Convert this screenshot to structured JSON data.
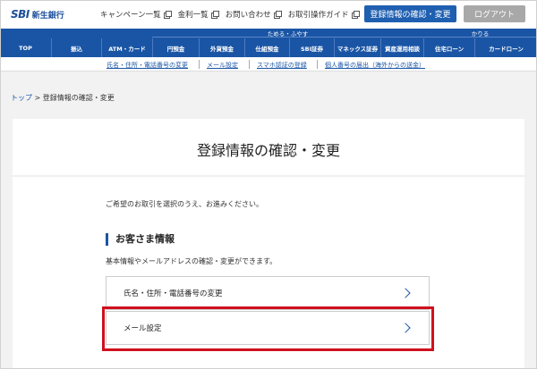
{
  "header": {
    "logo_mark": "SBI",
    "logo_name": "新生銀行",
    "top_links": [
      "キャンペーン一覧",
      "金利一覧",
      "お問い合わせ",
      "お取引操作ガイド"
    ],
    "register_button": "登録情報の確認・変更",
    "logout_button": "ログアウト"
  },
  "nav": {
    "groups": [
      "ためる・ふやす",
      "かりる"
    ],
    "items": [
      "TOP",
      "振込",
      "ATM・カード",
      "円預金",
      "外貨預金",
      "仕組預金",
      "SBI証券",
      "マネックス証券",
      "資産運用相談",
      "住宅ローン",
      "カードローン"
    ]
  },
  "subnav": {
    "links": [
      "氏名・住所・電話番号の変更",
      "メール設定",
      "スマホ認証の登録",
      "個人番号の届出（海外からの送金）"
    ]
  },
  "breadcrumb": {
    "home": "トップ",
    "separator": ">",
    "current": "登録情報の確認・変更"
  },
  "main": {
    "title": "登録情報の確認・変更",
    "intro": "ご希望のお取引を選択のうえ、お進みください。",
    "section_heading": "お客さま情報",
    "section_desc": "基本情報やメールアドレスの確認・変更ができます。",
    "menu_items": [
      "氏名・住所・電話番号の変更",
      "メール設定"
    ]
  },
  "colors": {
    "brand_blue": "#1a55a5",
    "button_blue": "#1f5fb0",
    "logout_gray": "#a8a8a8",
    "highlight_red": "#d0101e"
  }
}
